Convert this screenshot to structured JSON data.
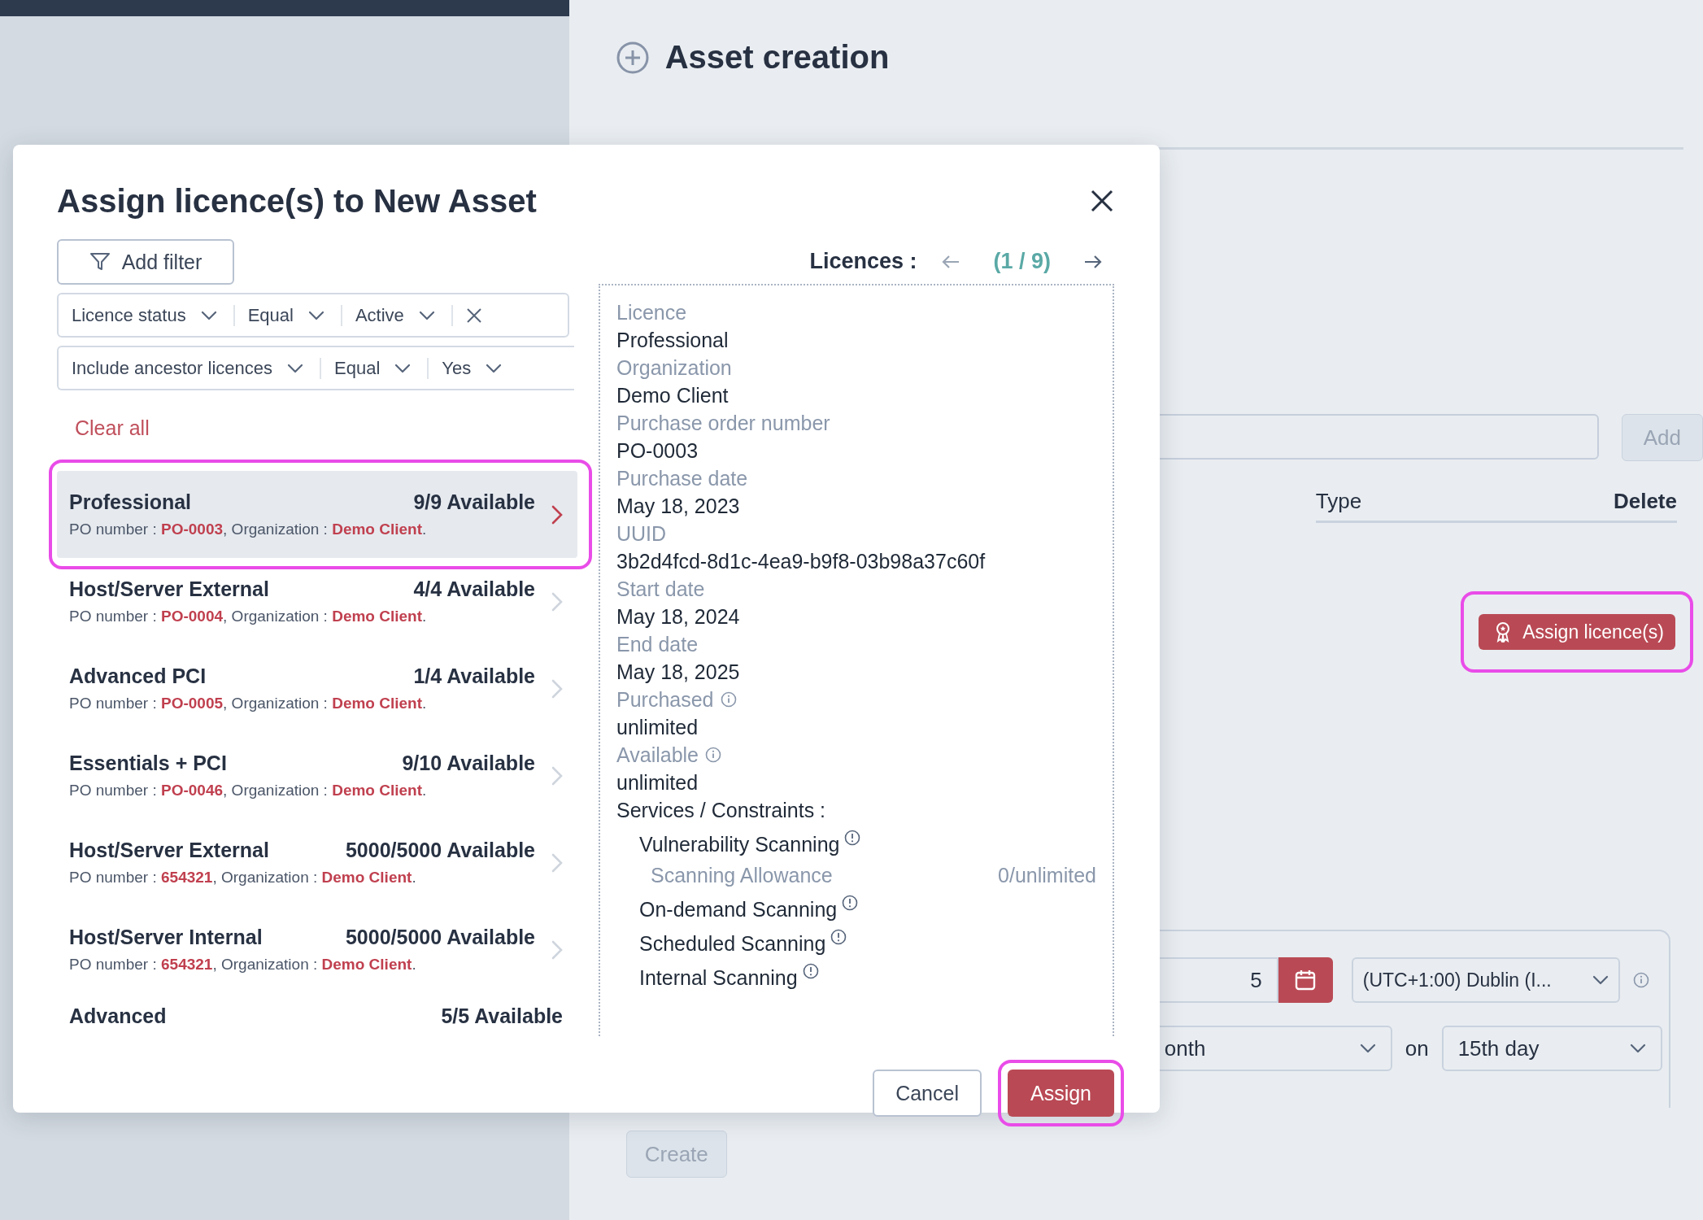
{
  "page": {
    "title": "Asset creation",
    "add_button": {
      "label": "Add",
      "disabled": true
    },
    "table_columns": [
      {
        "label": "Type",
        "bold": false
      },
      {
        "label": "Delete",
        "bold": true
      }
    ],
    "assign_licences_button": {
      "label": "Assign licence(s)",
      "highlighted": true
    },
    "schedule": {
      "date_value": "5",
      "timezone": "(UTC+1:00) Dublin (I...",
      "frequency": "onth",
      "on_label": "on",
      "day": "15th day"
    },
    "create_button": {
      "label": "Create",
      "disabled": true
    }
  },
  "modal": {
    "title": "Assign licence(s) to New Asset",
    "add_filter": "Add filter",
    "filters": [
      {
        "field": "Licence status",
        "operator": "Equal",
        "value": "Active",
        "removable": true
      },
      {
        "field": "Include ancestor licences",
        "operator": "Equal",
        "value": "Yes",
        "removable": false
      }
    ],
    "clear_all": "Clear all",
    "licences": [
      {
        "name": "Professional",
        "availability": "9/9 Available",
        "details": "PO number : **PO-0003**, Organization : **Demo Client**.",
        "selected": true,
        "highlighted": true
      },
      {
        "name": "Host/Server External",
        "availability": "4/4 Available",
        "details": "PO number : **PO-0004**, Organization : **Demo Client**.",
        "selected": false,
        "highlighted": false
      },
      {
        "name": "Advanced PCI",
        "availability": "1/4 Available",
        "details": "PO number : **PO-0005**, Organization : **Demo Client**.",
        "selected": false,
        "highlighted": false
      },
      {
        "name": "Essentials + PCI",
        "availability": "9/10 Available",
        "details": "PO number : **PO-0046**, Organization : **Demo Client**.",
        "selected": false,
        "highlighted": false
      },
      {
        "name": "Host/Server External",
        "availability": "5000/5000 Available",
        "details": "PO number : **654321**, Organization : **Demo Client**.",
        "selected": false,
        "highlighted": false
      },
      {
        "name": "Host/Server Internal",
        "availability": "5000/5000 Available",
        "details": "PO number : **654321**, Organization : **Demo Client**.",
        "selected": false,
        "highlighted": false
      },
      {
        "name": "Advanced",
        "availability": "5/5 Available",
        "selected": false,
        "highlighted": false
      }
    ],
    "detail": {
      "heading": "Licences :",
      "pager": "(1 / 9)",
      "fields": [
        {
          "kind": "plain",
          "label": "Licence",
          "value": "Professional"
        },
        {
          "kind": "plain",
          "label": "Organization",
          "value": "Demo Client"
        },
        {
          "kind": "plain",
          "label": "Purchase order number",
          "value": "PO-0003"
        },
        {
          "kind": "plain",
          "label": "Purchase date",
          "value": "May 18, 2023"
        },
        {
          "kind": "plain",
          "label": "UUID",
          "value": "3b2d4fcd-8d1c-4ea9-b9f8-03b98a37c60f"
        },
        {
          "kind": "plain",
          "label": "Start date",
          "value": "May 18, 2024"
        },
        {
          "kind": "plain",
          "label": "End date",
          "value": "May 18, 2025"
        },
        {
          "kind": "info",
          "label": "Purchased",
          "value": "unlimited"
        },
        {
          "kind": "info",
          "label": "Available",
          "value": "unlimited"
        }
      ],
      "services_heading": "Services / Constraints :",
      "services": [
        {
          "kind": "service",
          "name": "Vulnerability Scanning"
        },
        {
          "kind": "allowance",
          "name": "Scanning Allowance",
          "value": "0/unlimited"
        },
        {
          "kind": "service",
          "name": "On-demand Scanning"
        },
        {
          "kind": "service",
          "name": "Scheduled Scanning"
        },
        {
          "kind": "service",
          "name": "Internal Scanning"
        }
      ]
    },
    "cancel_button": {
      "label": "Cancel"
    },
    "assign_button": {
      "label": "Assign",
      "highlighted": true
    }
  }
}
